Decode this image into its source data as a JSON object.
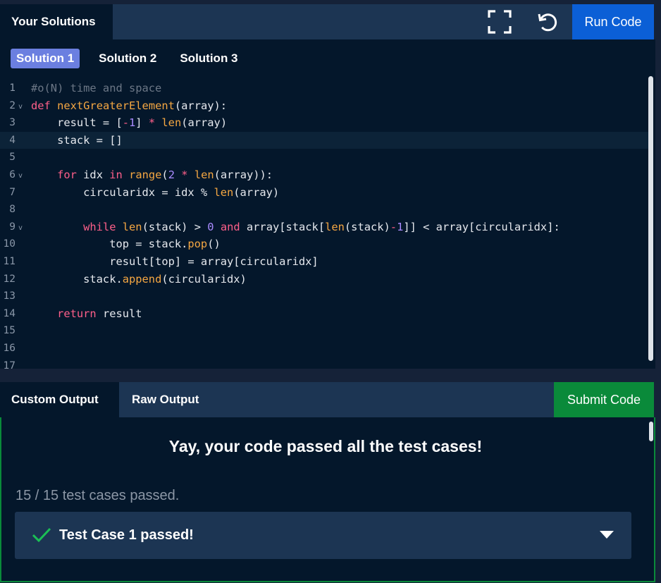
{
  "header": {
    "title": "Your Solutions",
    "fullscreen_icon": "fullscreen-icon",
    "reset_icon": "reset-icon",
    "run_label": "Run Code"
  },
  "solution_tabs": [
    {
      "label": "Solution 1",
      "active": true
    },
    {
      "label": "Solution 2",
      "active": false
    },
    {
      "label": "Solution 3",
      "active": false
    }
  ],
  "code": {
    "current_line": 4,
    "lines": [
      "#o(N) time and space",
      "def nextGreaterElement(array):",
      "    result = [-1] * len(array)",
      "    stack = []",
      "",
      "    for idx in range(2 * len(array)):",
      "        circularidx = idx % len(array)",
      "",
      "        while len(stack) > 0 and array[stack[len(stack)-1]] < array[circularidx]:",
      "            top = stack.pop()",
      "            result[top] = array[circularidx]",
      "        stack.append(circularidx)",
      "",
      "    return result",
      "",
      "",
      ""
    ],
    "line_numbers": [
      "1",
      "2",
      "3",
      "4",
      "5",
      "6",
      "7",
      "8",
      "9",
      "10",
      "11",
      "12",
      "13",
      "14",
      "15",
      "16",
      "17"
    ],
    "fold_lines": [
      2,
      6,
      9
    ]
  },
  "output": {
    "tabs": [
      {
        "label": "Custom Output",
        "active": true
      },
      {
        "label": "Raw Output",
        "active": false
      }
    ],
    "submit_label": "Submit Code",
    "success_message": "Yay, your code passed all the test cases!",
    "summary": "15 / 15 test cases passed.",
    "test_case": {
      "label": "Test Case 1 passed!",
      "icon": "check-icon",
      "expand_icon": "caret-down-icon"
    }
  },
  "colors": {
    "run_button": "#0b5fd6",
    "submit_button": "#0a8a3a",
    "active_tab": "#6b7fe0",
    "check": "#1bbf55"
  }
}
